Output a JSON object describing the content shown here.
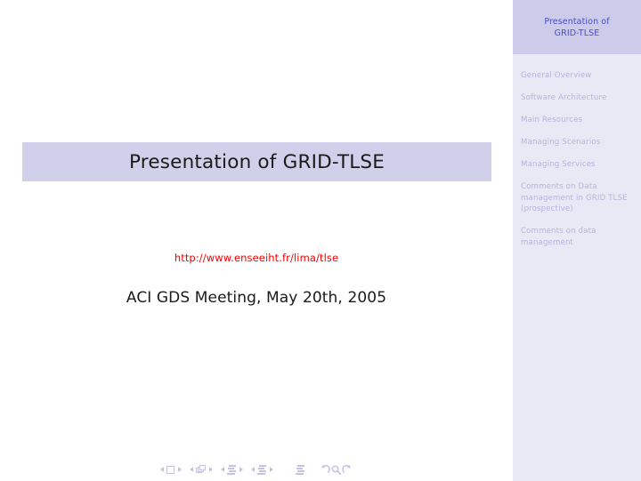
{
  "slide": {
    "title": "Presentation of GRID-TLSE",
    "url": "http://www.enseeiht.fr/lima/tlse",
    "event": "ACI GDS Meeting, May 20th, 2005"
  },
  "sidebar": {
    "header_line1": "Presentation of",
    "header_line2": "GRID-TLSE",
    "items": [
      {
        "label": "General Overview"
      },
      {
        "label": "Software Architecture"
      },
      {
        "label": "Main Resources"
      },
      {
        "label": "Managing Scenarios"
      },
      {
        "label": "Managing Services"
      },
      {
        "label": "Comments on Data management in GRID TLSE (prospective)"
      },
      {
        "label": "Comments on data management"
      }
    ]
  },
  "navbar": {
    "groups": [
      {
        "prev": "previous-slide",
        "icon": "slide-icon",
        "next": "next-slide"
      },
      {
        "prev": "previous-frame",
        "icon": "frames-icon",
        "next": "next-frame"
      },
      {
        "prev": "previous-subsection",
        "icon": "subsection-icon",
        "next": "next-subsection"
      },
      {
        "prev": "previous-section",
        "icon": "section-icon",
        "next": "next-section"
      }
    ],
    "document_icon": "document-icon",
    "back_icon": "back-arrow-icon",
    "search_icon": "search-icon",
    "forward_icon": "forward-arrow-icon"
  },
  "colors": {
    "sidebar_bg": "#e9e9f6",
    "sidebar_header_bg": "#ccccea",
    "sidebar_header_text": "#4b4bc4",
    "sidebar_item_text": "#b4b4db",
    "title_band_bg": "#d0d0ea",
    "title_text": "#1a1a1a",
    "url_text": "#f40000",
    "nav_icon": "#c3c3e4"
  }
}
